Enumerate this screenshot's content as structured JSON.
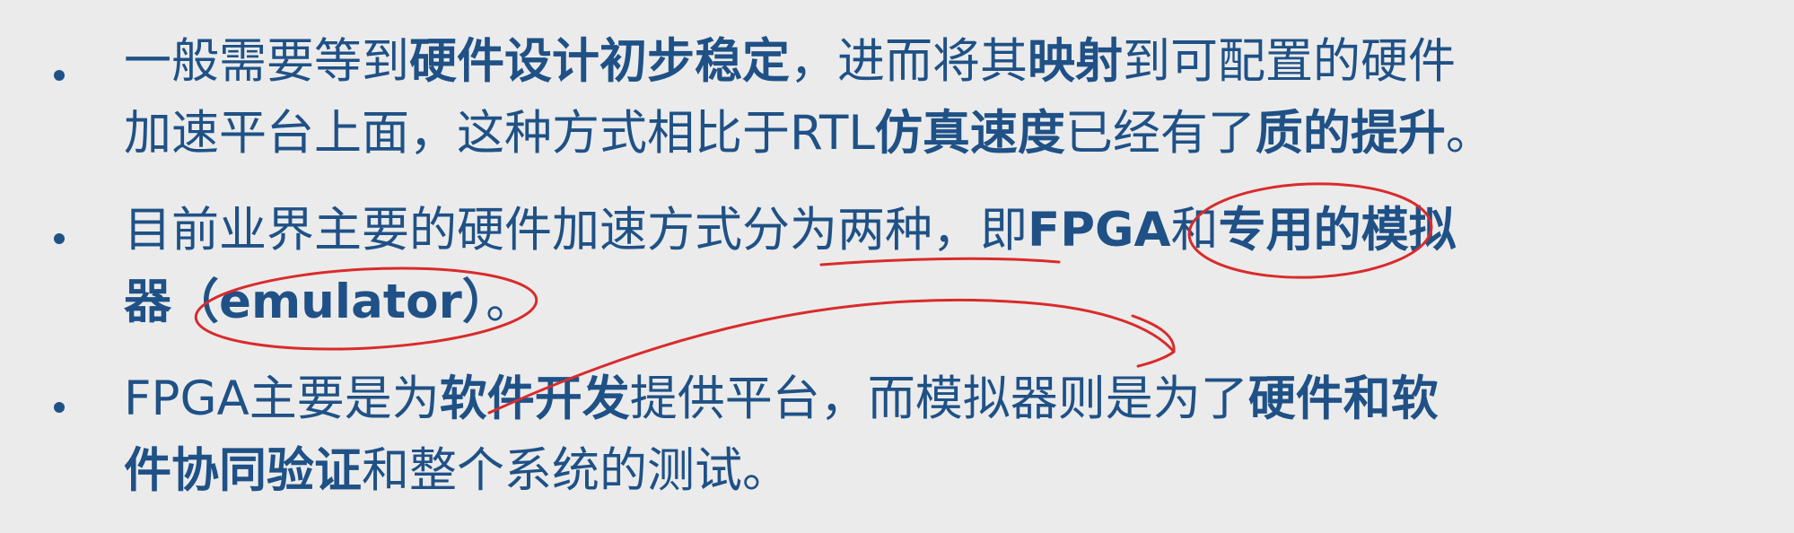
{
  "bullets": [
    {
      "lines": [
        [
          {
            "text": "一般需要等到",
            "bold": false
          },
          {
            "text": "硬件设计初步稳定",
            "bold": true
          },
          {
            "text": "，进而将其",
            "bold": false
          },
          {
            "text": "映射",
            "bold": true
          },
          {
            "text": "到可配置的硬件",
            "bold": false
          }
        ],
        [
          {
            "text": "加速平台上面，这种方式相比于RTL",
            "bold": false
          },
          {
            "text": "仿真速度",
            "bold": true
          },
          {
            "text": "已经有了",
            "bold": false
          },
          {
            "text": "质的提升",
            "bold": true
          },
          {
            "text": "。",
            "bold": false
          }
        ]
      ]
    },
    {
      "lines": [
        [
          {
            "text": "目前业界主要的硬件加速方式分为两种，即",
            "bold": false
          },
          {
            "text": "FPGA",
            "bold": true
          },
          {
            "text": "和",
            "bold": false
          },
          {
            "text": "专用的模拟",
            "bold": true
          }
        ],
        [
          {
            "text": "器（emulator）",
            "bold": true
          },
          {
            "text": "。",
            "bold": false
          }
        ]
      ]
    },
    {
      "lines": [
        [
          {
            "text": "FPGA主要是为",
            "bold": false
          },
          {
            "text": "软件开发",
            "bold": true
          },
          {
            "text": "提供平台，而模拟器则是为了",
            "bold": false
          },
          {
            "text": "硬件和软",
            "bold": true
          }
        ],
        [
          {
            "text": "件协同验证",
            "bold": true
          },
          {
            "text": "和整个系统的测试。",
            "bold": false
          }
        ]
      ]
    }
  ],
  "colors": {
    "background": "#ebebeb",
    "text": "#1f5186",
    "annotation_ink": "#d92b2b"
  }
}
